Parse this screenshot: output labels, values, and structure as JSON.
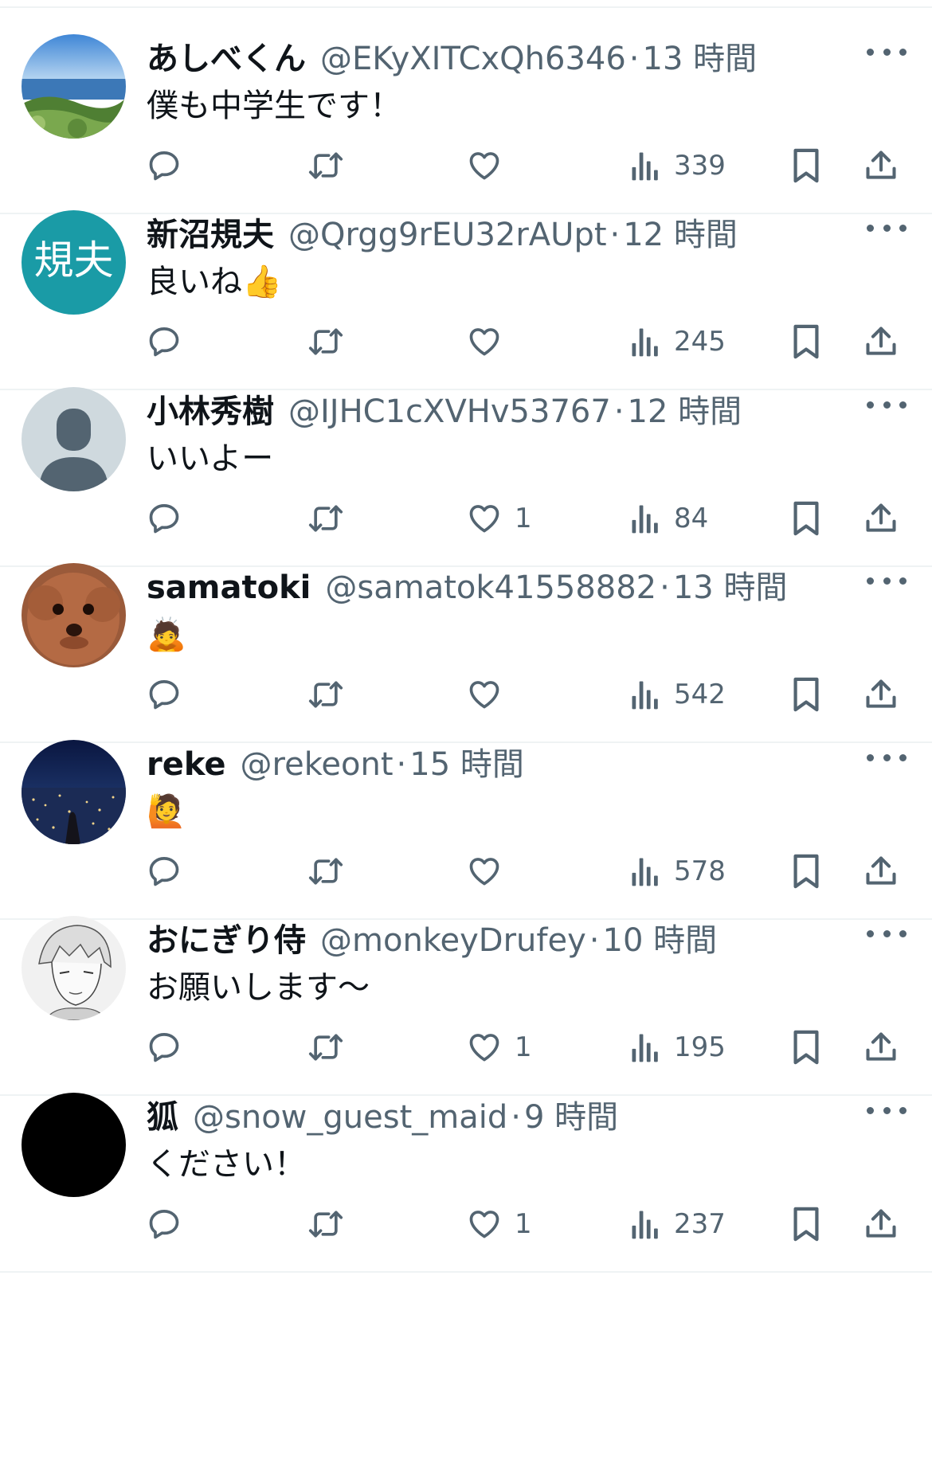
{
  "tweets": [
    {
      "display_name": "あしべくん",
      "handle": "@EKyXITCxQh6346",
      "separator": "·",
      "time": "13 時間",
      "text": "僕も中学生です！",
      "likes": "",
      "views": "339",
      "avatar": "landscape-lake"
    },
    {
      "display_name": "新沼規夫",
      "handle": "@Qrgg9rEU32rAUpt",
      "separator": "·",
      "time": "12 時間",
      "text": "良いね👍",
      "likes": "",
      "views": "245",
      "avatar": "initials",
      "avatar_text": "規夫",
      "avatar_color": "#1a9ba6"
    },
    {
      "display_name": "小林秀樹",
      "handle": "@IJHC1cXVHv53767",
      "separator": "·",
      "time": "12 時間",
      "text": "いいよー",
      "likes": "1",
      "views": "84",
      "avatar": "default-profile"
    },
    {
      "display_name": "samatoki",
      "handle": "@samatok41558882",
      "separator": "·",
      "time": "13 時間",
      "text": "🙇",
      "likes": "",
      "views": "542",
      "avatar": "dog"
    },
    {
      "display_name": "reke",
      "handle": "@rekeont",
      "separator": "·",
      "time": "15 時間",
      "text": "🙋",
      "likes": "",
      "views": "578",
      "avatar": "night-city"
    },
    {
      "display_name": "おにぎり侍",
      "handle": "@monkeyDrufey",
      "separator": "·",
      "time": "10 時間",
      "text": "お願いします〜",
      "likes": "1",
      "views": "195",
      "avatar": "manga-sketch"
    },
    {
      "display_name": "狐",
      "handle": "@snow_guest_maid",
      "separator": "·",
      "time": "9 時間",
      "text": "ください！",
      "likes": "1",
      "views": "237",
      "avatar": "black"
    }
  ],
  "colors": {
    "text": "#0f1419",
    "secondary": "#536471",
    "divider": "#eff3f4"
  },
  "icons": [
    "reply-icon",
    "retweet-icon",
    "like-icon",
    "views-icon",
    "bookmark-icon",
    "share-icon",
    "more-icon"
  ]
}
